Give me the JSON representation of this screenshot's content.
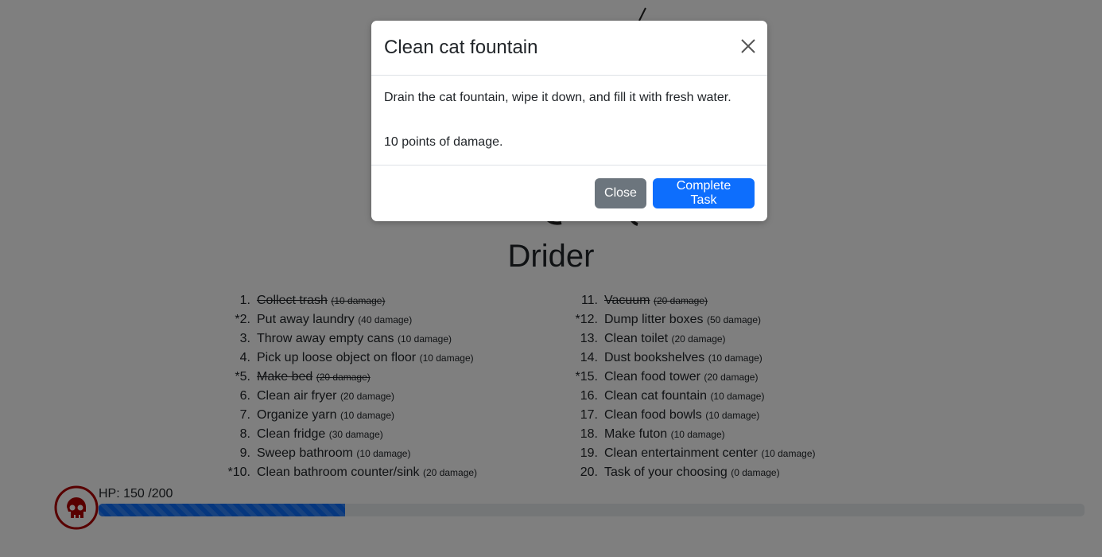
{
  "monster": {
    "name": "Drider"
  },
  "tasks_left": [
    {
      "num": "1.",
      "name": "Collect trash",
      "damage": "(10 damage)",
      "done": true
    },
    {
      "num": "*2.",
      "name": "Put away laundry",
      "damage": "(40 damage)",
      "done": false
    },
    {
      "num": "3.",
      "name": "Throw away empty cans",
      "damage": "(10 damage)",
      "done": false
    },
    {
      "num": "4.",
      "name": "Pick up loose object on floor",
      "damage": "(10 damage)",
      "done": false
    },
    {
      "num": "*5.",
      "name": "Make bed",
      "damage": "(20 damage)",
      "done": true
    },
    {
      "num": "6.",
      "name": "Clean air fryer",
      "damage": "(20 damage)",
      "done": false
    },
    {
      "num": "7.",
      "name": "Organize yarn",
      "damage": "(10 damage)",
      "done": false
    },
    {
      "num": "8.",
      "name": "Clean fridge",
      "damage": "(30 damage)",
      "done": false
    },
    {
      "num": "9.",
      "name": "Sweep bathroom",
      "damage": "(10 damage)",
      "done": false
    },
    {
      "num": "*10.",
      "name": "Clean bathroom counter/sink",
      "damage": "(20 damage)",
      "done": false
    }
  ],
  "tasks_right": [
    {
      "num": "11.",
      "name": "Vacuum",
      "damage": "(20 damage)",
      "done": true
    },
    {
      "num": "*12.",
      "name": "Dump litter boxes",
      "damage": "(50 damage)",
      "done": false
    },
    {
      "num": "13.",
      "name": "Clean toilet",
      "damage": "(20 damage)",
      "done": false
    },
    {
      "num": "14.",
      "name": "Dust bookshelves",
      "damage": "(10 damage)",
      "done": false
    },
    {
      "num": "*15.",
      "name": "Clean food tower",
      "damage": "(20 damage)",
      "done": false
    },
    {
      "num": "16.",
      "name": "Clean cat fountain",
      "damage": "(10 damage)",
      "done": false
    },
    {
      "num": "17.",
      "name": "Clean food bowls",
      "damage": "(10 damage)",
      "done": false
    },
    {
      "num": "18.",
      "name": "Make futon",
      "damage": "(10 damage)",
      "done": false
    },
    {
      "num": "19.",
      "name": "Clean entertainment center",
      "damage": "(10 damage)",
      "done": false
    },
    {
      "num": "20.",
      "name": "Task of your choosing",
      "damage": "(0 damage)",
      "done": false
    }
  ],
  "hp": {
    "label": "HP: 150 /200",
    "current": 150,
    "max": 200,
    "fill_fraction": 0.25,
    "bar_color": "#0d6efd"
  },
  "modal": {
    "title": "Clean cat fountain",
    "description": "Drain the cat fountain, wipe it down, and fill it with fresh water.",
    "damage_text": "10 points of damage.",
    "close_label": "Close",
    "complete_label": "Complete Task"
  },
  "icons": {
    "skull": "skull-icon",
    "close": "close-icon",
    "monster": "spider-image"
  },
  "colors": {
    "primary": "#0d6efd",
    "secondary": "#6c757d",
    "skull": "#b00000"
  }
}
